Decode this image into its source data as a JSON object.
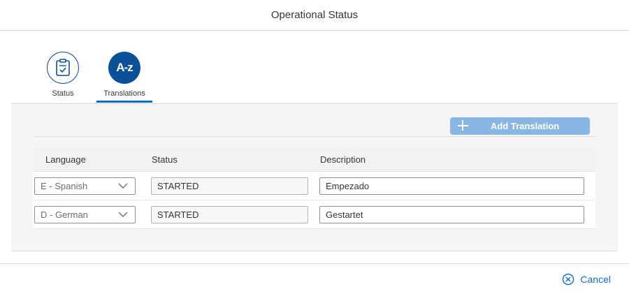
{
  "dialog": {
    "title": "Operational Status"
  },
  "tabs": [
    {
      "label": "Status",
      "icon": "clipboard-check-icon",
      "selected": false
    },
    {
      "label": "Translations",
      "icon": "az-icon",
      "icon_text": "A-z",
      "selected": true
    }
  ],
  "toolbar": {
    "add_label": "Add Translation"
  },
  "table": {
    "columns": [
      "Language",
      "Status",
      "Description"
    ],
    "rows": [
      {
        "language": "E - Spanish",
        "status": "STARTED",
        "description": "Empezado"
      },
      {
        "language": "D - German",
        "status": "STARTED",
        "description": "Gestartet"
      }
    ]
  },
  "footer": {
    "cancel_label": "Cancel"
  },
  "colors": {
    "accent": "#0a6ed1",
    "tab_icon": "#0a5197",
    "add_button": "#89b7e5"
  }
}
